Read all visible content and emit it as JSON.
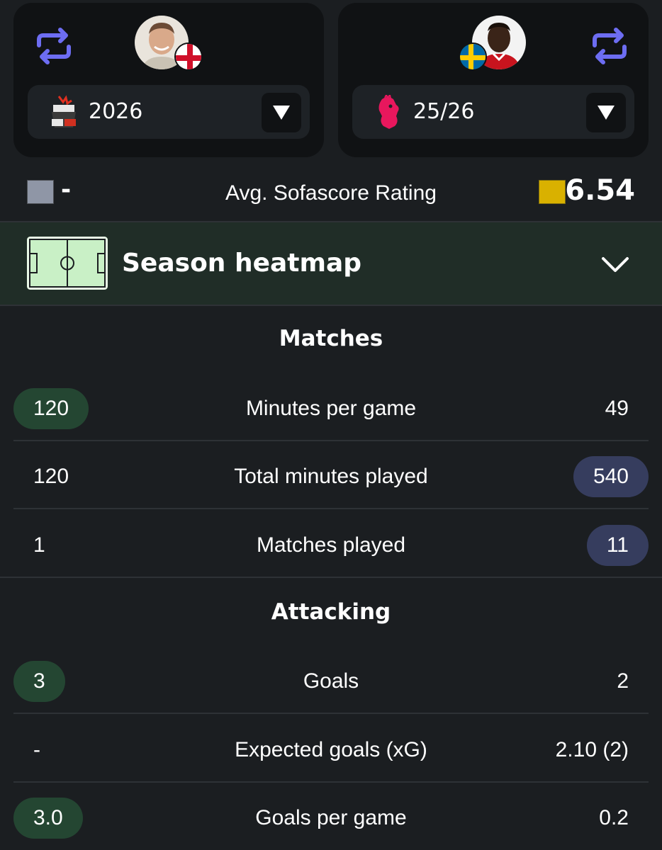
{
  "players": {
    "left": {
      "season": "2026",
      "competition_icon": "club-crest-icon",
      "flag": "england-flag"
    },
    "right": {
      "season": "25/26",
      "competition_icon": "premier-league-lion-icon",
      "flag": "sweden-flag"
    }
  },
  "rating": {
    "left_value": "-",
    "label": "Avg. Sofascore Rating",
    "right_value": "6.54",
    "left_color": "#8f96a6",
    "right_color": "#d9b100"
  },
  "heatmap": {
    "title": "Season heatmap"
  },
  "sections": [
    {
      "title": "Matches",
      "rows": [
        {
          "label": "Minutes per game",
          "left": "120",
          "right": "49",
          "highlight": "left"
        },
        {
          "label": "Total minutes played",
          "left": "120",
          "right": "540",
          "highlight": "right"
        },
        {
          "label": "Matches played",
          "left": "1",
          "right": "11",
          "highlight": "right"
        }
      ]
    },
    {
      "title": "Attacking",
      "rows": [
        {
          "label": "Goals",
          "left": "3",
          "right": "2",
          "highlight": "left"
        },
        {
          "label": "Expected goals (xG)",
          "left": "-",
          "right": "2.10 (2)",
          "highlight": "none"
        },
        {
          "label": "Goals per game",
          "left": "3.0",
          "right": "0.2",
          "highlight": "left"
        }
      ]
    }
  ],
  "colors": {
    "highlight_left": "#244632",
    "highlight_right": "#363d5e",
    "accent_swap": "#6d6df2"
  }
}
